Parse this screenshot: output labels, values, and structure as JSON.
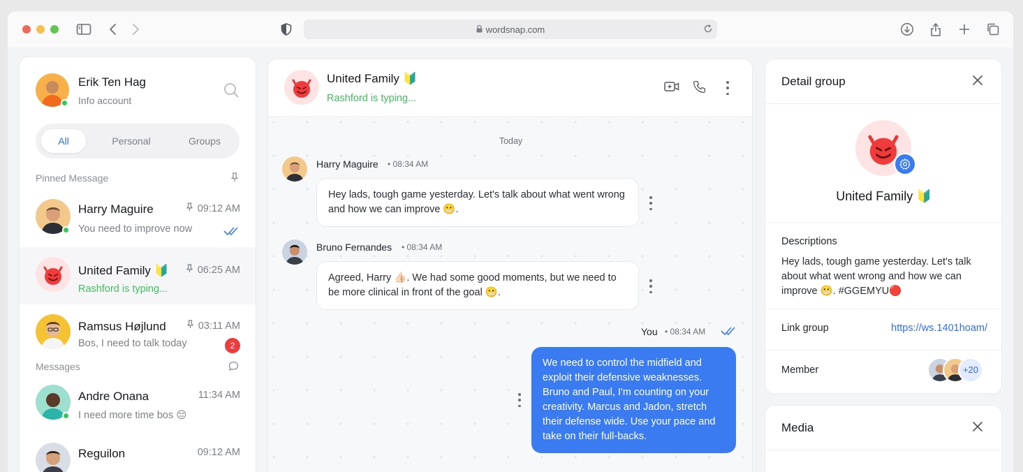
{
  "browser": {
    "url": "wordsnap.com",
    "traffic_lights": [
      "#ed6a5e",
      "#f5bf4f",
      "#61c554"
    ]
  },
  "profile": {
    "name": "Erik Ten Hag",
    "subtitle": "Info account"
  },
  "filter_tabs": [
    {
      "label": "All",
      "active": true
    },
    {
      "label": "Personal",
      "active": false
    },
    {
      "label": "Groups",
      "active": false
    }
  ],
  "pinned_label": "Pinned Message",
  "messages_label": "Messages",
  "chats": [
    {
      "name": "Harry Maguire",
      "message": "You need to improve now",
      "time": "09:12 AM",
      "pinned": true
    },
    {
      "name": "United Family 🔰",
      "message": "Rashford is typing...",
      "time": "06:25 AM",
      "pinned": true
    },
    {
      "name": "Ramsus Højlund",
      "message": "Bos, I need to talk today",
      "time": "03:11 AM",
      "pinned": true,
      "unread": "2"
    },
    {
      "name": "Andre Onana",
      "message": "I need more time bos 😔",
      "time": "11:34 AM"
    },
    {
      "name": "Reguilon",
      "message": "",
      "time": "09:12 AM"
    }
  ],
  "conversation": {
    "title": "United Family 🔰",
    "status": "Rashford is typing...",
    "day": "Today",
    "messages": [
      {
        "sender": "Harry Maguire",
        "time": "08:34 AM",
        "text": "Hey lads, tough game yesterday. Let's talk about what went wrong and how we can improve 😬."
      },
      {
        "sender": "Bruno Fernandes",
        "time": "08:34 AM",
        "text": "Agreed, Harry 👍🏻. We had some good moments, but we need to be more clinical in front of the goal 😬."
      },
      {
        "sender": "You",
        "time": "08:34 AM",
        "text": "We need to control the midfield and exploit their defensive weaknesses. Bruno and Paul, I'm counting on your creativity. Marcus and Jadon, stretch their defense wide. Use your pace and take on their full-backs."
      }
    ]
  },
  "detail": {
    "title": "Detail group",
    "group_name": "United Family 🔰",
    "descriptions_label": "Descriptions",
    "description": "Hey lads, tough game yesterday. Let's talk about what went wrong and how we can improve 😬. #GGEMYU🔴",
    "link_label": "Link group",
    "link": "https://ws.1401hoam/",
    "member_label": "Member",
    "member_extra": "+20"
  },
  "media": {
    "title": "Media"
  }
}
